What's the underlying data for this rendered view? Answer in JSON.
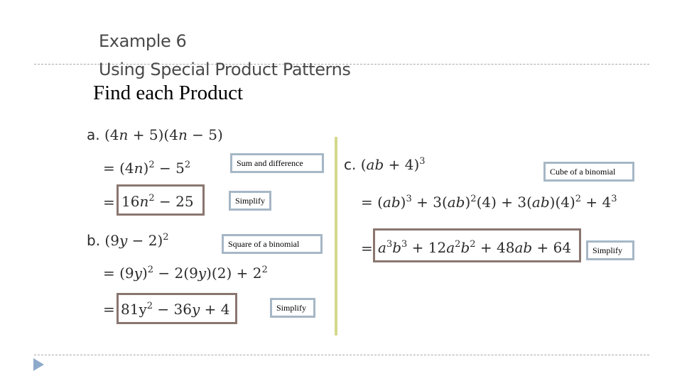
{
  "slide": {
    "title_line1": "Example 6",
    "title_line2": "Using Special Product Patterns",
    "heading": "Find each Product"
  },
  "problems": {
    "a": {
      "label": "a.",
      "expression": "(4n + 5)(4n − 5)",
      "step1": "= (4n)² − 5²",
      "answer": "16n² − 25",
      "notes": [
        "Sum and difference",
        "Simplify"
      ]
    },
    "b": {
      "label": "b.",
      "expression": "(9y − 2)²",
      "step1": "= (9y)² − 2(9y)(2) + 2²",
      "answer": "81y² − 36y + 4",
      "notes": [
        "Square of a binomial",
        "Simplify"
      ]
    },
    "c": {
      "label": "c.",
      "expression": "(ab + 4)³",
      "step1": "= (ab)³ + 3(ab)²(4) + 3(ab)(4)² + 4³",
      "answer": "a³b³ + 12a²b² + 48ab + 64",
      "notes": [
        "Cube of a binomial",
        "Simplify"
      ]
    }
  },
  "colors": {
    "answer_box_border": "#8a7670",
    "note_box_border": "#a6b7c6",
    "divider": "#d3d98c",
    "bullet_arrow": "#8eaacb"
  },
  "icons": {
    "bullet": "play-arrow-icon"
  }
}
